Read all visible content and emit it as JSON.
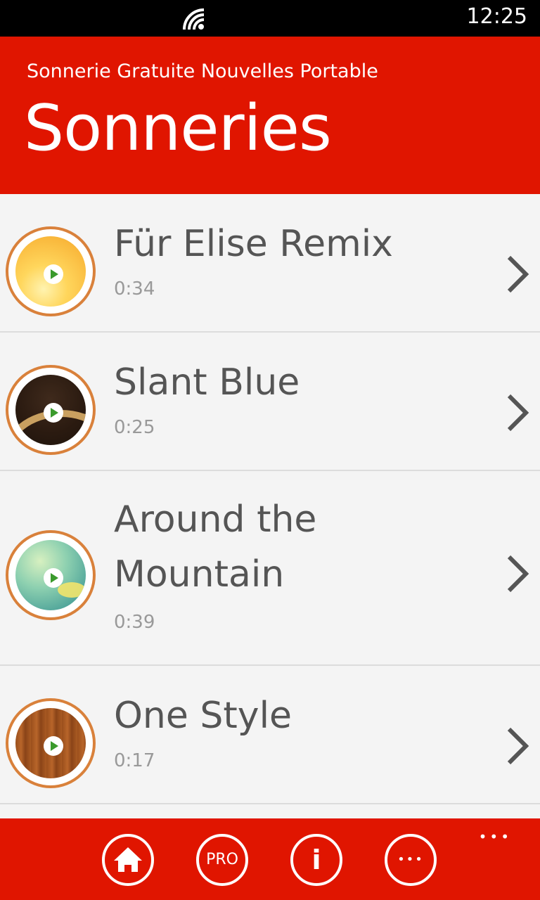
{
  "status_bar": {
    "time": "12:25",
    "signal_icon": "wifi-signal-icon"
  },
  "header": {
    "app_title": "Sonnerie Gratuite Nouvelles Portable",
    "page_title": "Sonneries"
  },
  "ringtones": [
    {
      "title": "Für Elise Remix",
      "duration": "0:34",
      "art": "golden-disc-art"
    },
    {
      "title": "Slant Blue",
      "duration": "0:25",
      "art": "dark-brown-disc-art"
    },
    {
      "title_line1": "Around the",
      "title_line2": "Mountain",
      "duration": "0:39",
      "art": "teal-bokeh-disc-art"
    },
    {
      "title": "One Style",
      "duration": "0:17",
      "art": "wood-disc-art"
    }
  ],
  "appbar": {
    "buttons": [
      {
        "icon": "home-icon"
      },
      {
        "label": "PRO",
        "icon": "pro-icon"
      },
      {
        "label": "i",
        "icon": "info-icon"
      },
      {
        "label": "•••",
        "icon": "more-icon"
      }
    ],
    "ellipsis": "•••"
  },
  "colors": {
    "accent": "#e01500",
    "status_bar": "#000000",
    "list_bg": "#f4f4f4",
    "ring": "#d9813b",
    "play": "#3a9a2c"
  }
}
